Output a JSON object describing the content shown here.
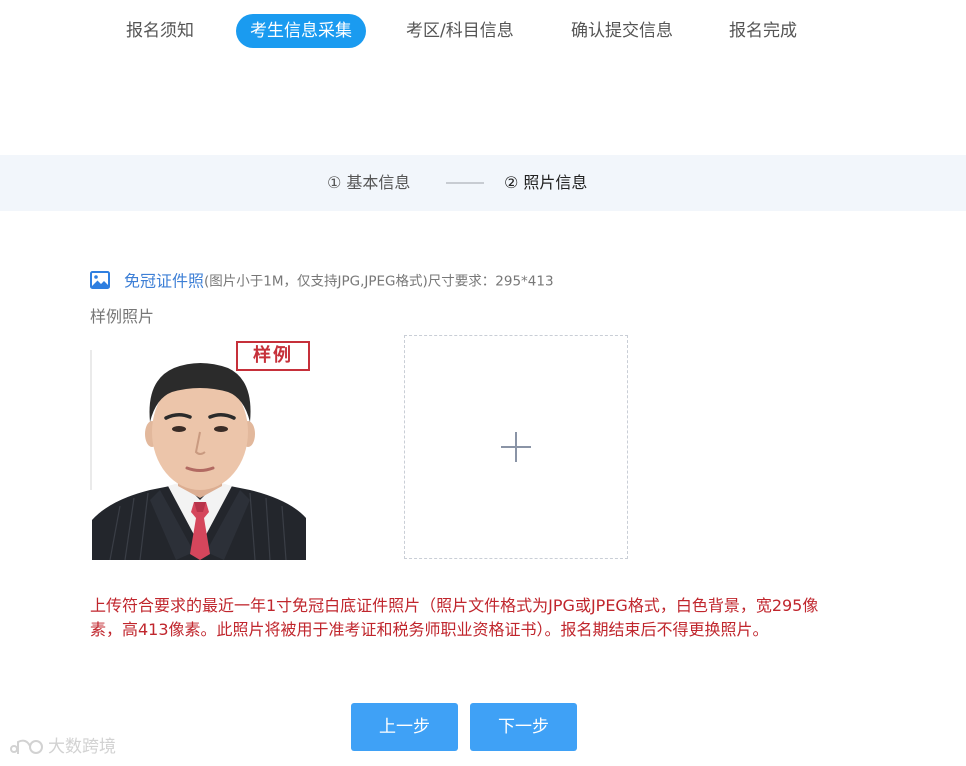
{
  "top_steps": [
    {
      "label": "报名须知",
      "active": false
    },
    {
      "label": "考生信息采集",
      "active": true
    },
    {
      "label": "考区/科目信息",
      "active": false
    },
    {
      "label": "确认提交信息",
      "active": false
    },
    {
      "label": "报名完成",
      "active": false
    }
  ],
  "sub_steps": [
    {
      "label": "① 基本信息",
      "current": false
    },
    {
      "label": "② 照片信息",
      "current": true
    }
  ],
  "photo_section": {
    "title": "免冠证件照",
    "requirement": "(图片小于1M，仅支持JPG,JPEG格式)尺寸要求：295*413",
    "sample_label": "样例照片",
    "sample_stamp": "样例",
    "notice": "上传符合要求的最近一年1寸免冠白底证件照片（照片文件格式为JPG或JPEG格式，白色背景，宽295像素，高413像素。此照片将被用于准考证和税务师职业资格证书）。报名期结束后不得更换照片。"
  },
  "buttons": {
    "prev": "上一步",
    "next": "下一步"
  },
  "watermark": {
    "text": "大数跨境"
  },
  "icons": {
    "photo_title": "image-icon",
    "upload": "plus-icon",
    "watermark": "brand-logo-icon"
  },
  "colors": {
    "accent": "#1a9bf0",
    "button": "#3fa1f6",
    "title_link": "#3d7fd6",
    "notice": "#c0262d",
    "band": "#f2f6fb"
  }
}
